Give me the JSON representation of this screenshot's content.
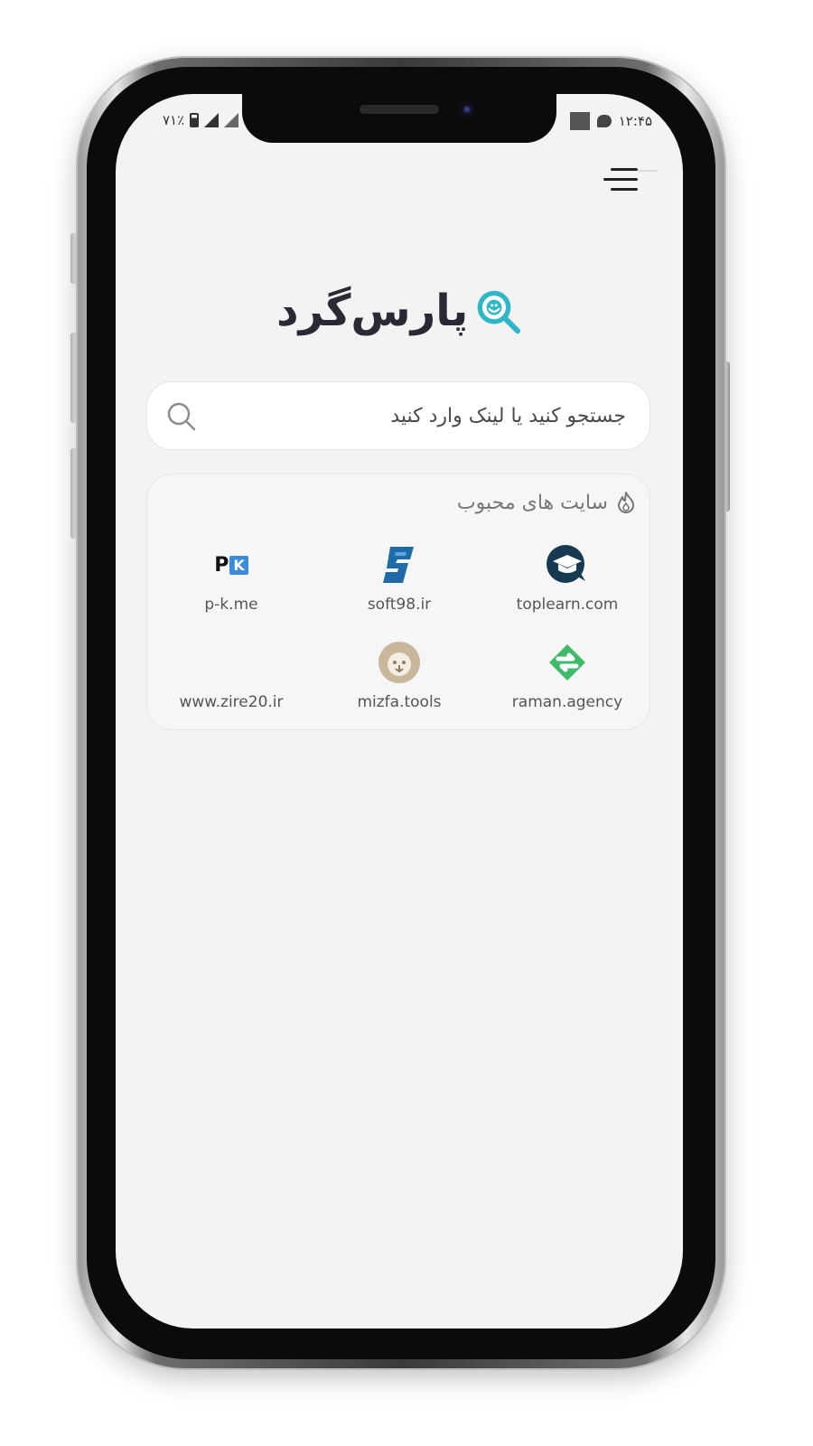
{
  "status_bar": {
    "battery_percent": "۷۱٪",
    "time": "۱۲:۴۵"
  },
  "app": {
    "logo_text": "پارس‌گرد",
    "brand_color": "#2fb7c8"
  },
  "search": {
    "placeholder": "جستجو کنید یا لینک وارد کنید",
    "value": ""
  },
  "popular": {
    "title": "سایت های محبوب",
    "sites": [
      {
        "label": "toplearn.com",
        "icon": "toplearn-logo-icon"
      },
      {
        "label": "soft98.ir",
        "icon": "soft98-logo-icon"
      },
      {
        "label": "p-k.me",
        "icon": "pk-logo-icon",
        "icon_text_p": "P",
        "icon_text_k": "K"
      },
      {
        "label": "raman.agency",
        "icon": "raman-logo-icon"
      },
      {
        "label": "mizfa.tools",
        "icon": "mizfa-lion-icon"
      },
      {
        "label": "www.zire20.ir",
        "icon": ""
      }
    ]
  }
}
